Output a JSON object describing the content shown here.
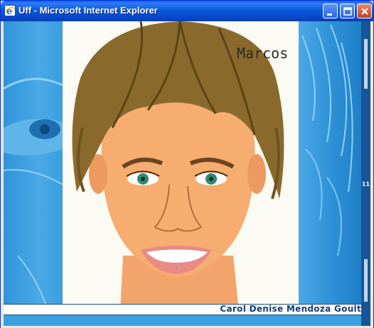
{
  "window": {
    "title": "Uff - Microsoft Internet Explorer",
    "controls": [
      "minimize",
      "maximize",
      "close"
    ],
    "icon": "internet-explorer-icon"
  },
  "artwork": {
    "signature": "Marcos",
    "side_number": "11",
    "caption": "Carol Denise Mendoza Goult"
  },
  "colors": {
    "titlebar": "#0a59db",
    "background_blue": "#2a8fd3",
    "strip": "#17549a",
    "caption_text": "#173d7a"
  }
}
